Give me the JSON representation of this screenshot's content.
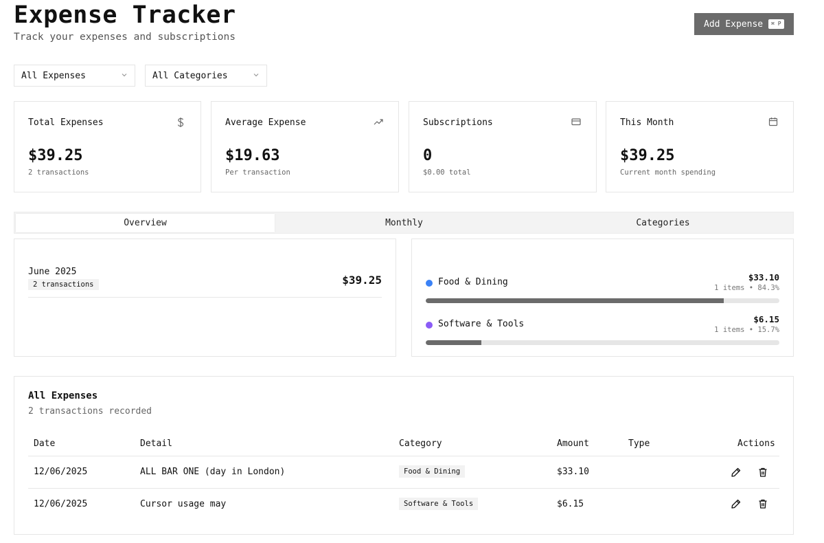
{
  "header": {
    "title": "Expense Tracker",
    "subtitle": "Track your expenses and subscriptions",
    "add_button": "Add Expense",
    "add_shortcut": "⌘ P"
  },
  "filters": {
    "type_select": "All Expenses",
    "category_select": "All Categories"
  },
  "stats": [
    {
      "title": "Total Expenses",
      "icon": "dollar-icon",
      "value": "$39.25",
      "sub": "2 transactions"
    },
    {
      "title": "Average Expense",
      "icon": "trending-up-icon",
      "value": "$19.63",
      "sub": "Per transaction"
    },
    {
      "title": "Subscriptions",
      "icon": "credit-card-icon",
      "value": "0",
      "sub": "$0.00 total"
    },
    {
      "title": "This Month",
      "icon": "calendar-icon",
      "value": "$39.25",
      "sub": "Current month spending"
    }
  ],
  "tabs": [
    {
      "label": "Overview",
      "active": true
    },
    {
      "label": "Monthly",
      "active": false
    },
    {
      "label": "Categories",
      "active": false
    }
  ],
  "monthly": {
    "month": "June 2025",
    "transactions": "2 transactions",
    "total": "$39.25"
  },
  "categories": [
    {
      "name": "Food & Dining",
      "amount": "$33.10",
      "meta": "1 items • 84.3%",
      "percent": 84.3,
      "color": "#3b82f6"
    },
    {
      "name": "Software & Tools",
      "amount": "$6.15",
      "meta": "1 items • 15.7%",
      "percent": 15.7,
      "color": "#8b5cf6"
    }
  ],
  "table": {
    "title": "All Expenses",
    "subtitle": "2 transactions recorded",
    "columns": [
      "Date",
      "Detail",
      "Category",
      "Amount",
      "Type",
      "Actions"
    ],
    "rows": [
      {
        "date": "12/06/2025",
        "detail": "ALL BAR ONE (day in London)",
        "category": "Food & Dining",
        "amount": "$33.10",
        "type": ""
      },
      {
        "date": "12/06/2025",
        "detail": "Cursor usage may",
        "category": "Software & Tools",
        "amount": "$6.15",
        "type": ""
      }
    ]
  }
}
